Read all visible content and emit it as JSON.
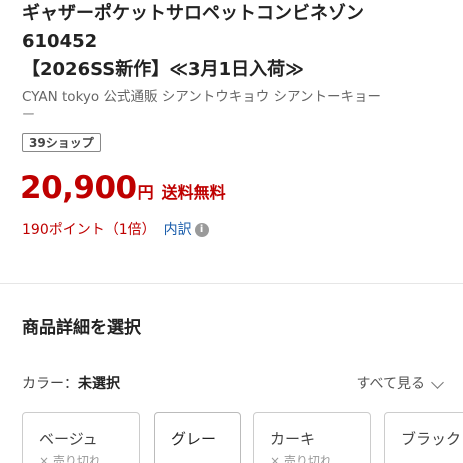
{
  "product": {
    "title_line1": "ギャザーポケットサロペットコンビネゾン",
    "title_line2": "610452",
    "title_line3": "【2026SS新作】≪3月1日入荷≫",
    "store_info": "CYAN tokyo 公式通販 シアントウキョウ シアントーキョー",
    "store_info_tail": "ー"
  },
  "badge": {
    "label": "39ショップ"
  },
  "price": {
    "amount": "20,900",
    "currency": "円",
    "shipping": "送料無料"
  },
  "points": {
    "text": "190ポイント（1倍）",
    "breakdown": "内訳",
    "info_icon": "info-icon"
  },
  "selection": {
    "title": "商品詳細を選択",
    "color_label": "カラー：",
    "color_value": "未選択",
    "see_all": "すべて見る"
  },
  "color_options": [
    {
      "name": "ベージュ",
      "status": "× 売り切れ"
    },
    {
      "name": "グレー",
      "status": ""
    },
    {
      "name": "カーキ",
      "status": "× 売り切れ"
    },
    {
      "name": "ブラック",
      "status": ""
    }
  ],
  "colors": {
    "price_red": "#bf0000",
    "link_blue": "#1a5dab"
  }
}
